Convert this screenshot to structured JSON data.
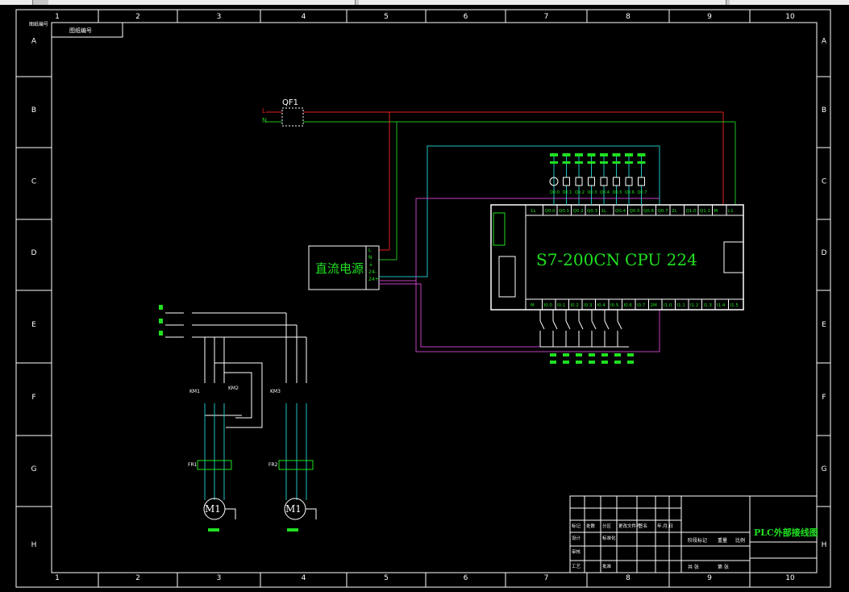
{
  "border": {
    "cols": [
      "1",
      "2",
      "3",
      "4",
      "5",
      "6",
      "7",
      "8",
      "9",
      "10"
    ],
    "rows": [
      "A",
      "B",
      "C",
      "D",
      "E",
      "F",
      "G",
      "H"
    ]
  },
  "corner_note": "图纸编号",
  "qf_label": "QF1",
  "line_labels": {
    "L": "L",
    "N": "N"
  },
  "dc_supply": "直流电源",
  "dc_terminals": [
    "L",
    "N",
    "⏚",
    "24-",
    "24+"
  ],
  "plc": {
    "model": "S7-200CN",
    "cpu": "CPU 224",
    "side_top": "M",
    "side_bot": "M"
  },
  "outputs": [
    "Q0.0",
    "Q0.1",
    "Q0.2",
    "Q0.3",
    "Q0.4",
    "Q0.5",
    "Q0.6",
    "Q0.7"
  ],
  "top_terms": [
    "1L",
    "Q0.0",
    "Q0.1",
    "Q0.2",
    "Q0.3",
    "1L",
    "Q0.4",
    "Q0.5",
    "Q0.6",
    "Q0.7",
    "2L",
    "Q1.0",
    "Q1.1",
    "M",
    "L1"
  ],
  "bot_terms": [
    "M",
    "I0.0",
    "I0.1",
    "I0.2",
    "I0.3",
    "I0.4",
    "I0.5",
    "I0.6",
    "I0.7",
    "2M",
    "I1.0",
    "I1.1",
    "I1.2",
    "I1.3",
    "I1.4",
    "I1.5"
  ],
  "motors": [
    {
      "label": "M1",
      "km_a": "KM1",
      "km_b": "KM2",
      "fr": "FR1"
    },
    {
      "label": "M1",
      "km_a": "KM3",
      "fr": "FR2"
    }
  ],
  "title_block": {
    "title": "PLC外部接线图",
    "rows": [
      [
        "标记",
        "处数",
        "分区",
        "更改文件号",
        "签名",
        "年.月.日"
      ],
      [
        "设计",
        "",
        "标准化",
        "",
        "",
        ""
      ],
      [
        "审核",
        "",
        "",
        "",
        "",
        ""
      ],
      [
        "工艺",
        "",
        "批准",
        "",
        "",
        ""
      ]
    ],
    "right_labels": [
      "阶段标记",
      "重量",
      "比例"
    ],
    "sheet": [
      "共 张",
      "第 张"
    ]
  }
}
